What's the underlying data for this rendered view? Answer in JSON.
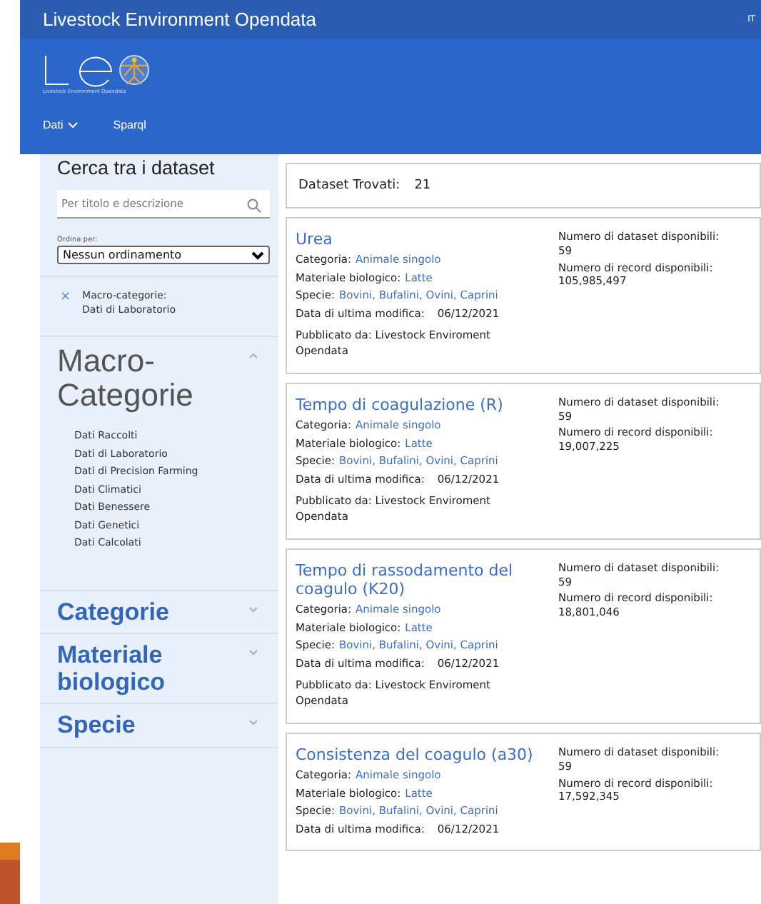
{
  "top_bar": {
    "title": "Livestock Environment Opendata",
    "language": "IT"
  },
  "logo": {
    "caption": "Livestock Environment Opendata"
  },
  "nav": [
    {
      "label": "Dati",
      "dropdown": true
    },
    {
      "label": "Sparql",
      "dropdown": false
    }
  ],
  "sidebar": {
    "heading": "Cerca tra i dataset",
    "search": {
      "placeholder": "Per titolo e descrizione"
    },
    "sort": {
      "label": "Ordina per:",
      "value": "Nessun ordinamento"
    },
    "active_filter": {
      "remove": "×",
      "text": "Macro-categorie:",
      "value": "Dati di Laboratorio"
    },
    "sections": [
      {
        "title": "Macro-Categorie",
        "expanded": true,
        "items": [
          "Dati Raccolti",
          "Dati di Laboratorio",
          "Dati di Precision Farming",
          "Dati Climatici",
          "Dati Benessere",
          "Dati Genetici",
          "Dati Calcolati"
        ]
      },
      {
        "title": "Categorie",
        "expanded": false
      },
      {
        "title": "Materiale biologico",
        "expanded": false
      },
      {
        "title": "Specie",
        "expanded": false
      }
    ]
  },
  "results": {
    "label": "Dataset Trovati:",
    "count": "21",
    "datasets": [
      {
        "title": "Urea",
        "fields": [
          {
            "label": "Categoria:",
            "value": "Animale singolo",
            "kind": "link"
          },
          {
            "label": "Materiale biologico:",
            "value": "Latte",
            "kind": "link"
          },
          {
            "label": "Specie:",
            "value": "Bovini, Bufalini, Ovini, Caprini",
            "kind": "link"
          },
          {
            "label": "Data di ultima modifica:",
            "value": "06/12/2021",
            "kind": "date"
          }
        ],
        "publisher": "Pubblicato da: Livestock Enviroment Opendata",
        "stats": [
          {
            "label": "Numero di dataset disponibili:",
            "value": "59"
          },
          {
            "label": "Numero di record disponibili:",
            "value": "105,985,497"
          }
        ]
      },
      {
        "title": "Tempo di coagulazione (R)",
        "fields": [
          {
            "label": "Categoria:",
            "value": "Animale singolo",
            "kind": "link"
          },
          {
            "label": "Materiale biologico:",
            "value": "Latte",
            "kind": "link"
          },
          {
            "label": "Specie:",
            "value": "Bovini, Bufalini, Ovini, Caprini",
            "kind": "link"
          },
          {
            "label": "Data di ultima modifica:",
            "value": "06/12/2021",
            "kind": "date"
          }
        ],
        "publisher": "Pubblicato da: Livestock Enviroment Opendata",
        "stats": [
          {
            "label": "Numero di dataset disponibili:",
            "value": "59"
          },
          {
            "label": "Numero di record disponibili:",
            "value": "19,007,225"
          }
        ]
      },
      {
        "title": "Tempo di rassodamento del coagulo (K20)",
        "fields": [
          {
            "label": "Categoria:",
            "value": "Animale singolo",
            "kind": "link"
          },
          {
            "label": "Materiale biologico:",
            "value": "Latte",
            "kind": "link"
          },
          {
            "label": "Specie:",
            "value": "Bovini, Bufalini, Ovini, Caprini",
            "kind": "link"
          },
          {
            "label": "Data di ultima modifica:",
            "value": "06/12/2021",
            "kind": "date"
          }
        ],
        "publisher": "Pubblicato da: Livestock Enviroment Opendata",
        "stats": [
          {
            "label": "Numero di dataset disponibili:",
            "value": "59"
          },
          {
            "label": "Numero di record disponibili:",
            "value": "18,801,046"
          }
        ]
      },
      {
        "title": "Consistenza del coagulo (a30)",
        "fields": [
          {
            "label": "Categoria:",
            "value": "Animale singolo",
            "kind": "link"
          },
          {
            "label": "Materiale biologico:",
            "value": "Latte",
            "kind": "link"
          },
          {
            "label": "Specie:",
            "value": "Bovini, Bufalini, Ovini, Caprini",
            "kind": "link"
          },
          {
            "label": "Data di ultima modifica:",
            "value": "06/12/2021",
            "kind": "date"
          }
        ],
        "stats": [
          {
            "label": "Numero di dataset disponibili:",
            "value": "59"
          },
          {
            "label": "Numero di record disponibili:",
            "value": "17,592,345"
          }
        ]
      }
    ]
  }
}
